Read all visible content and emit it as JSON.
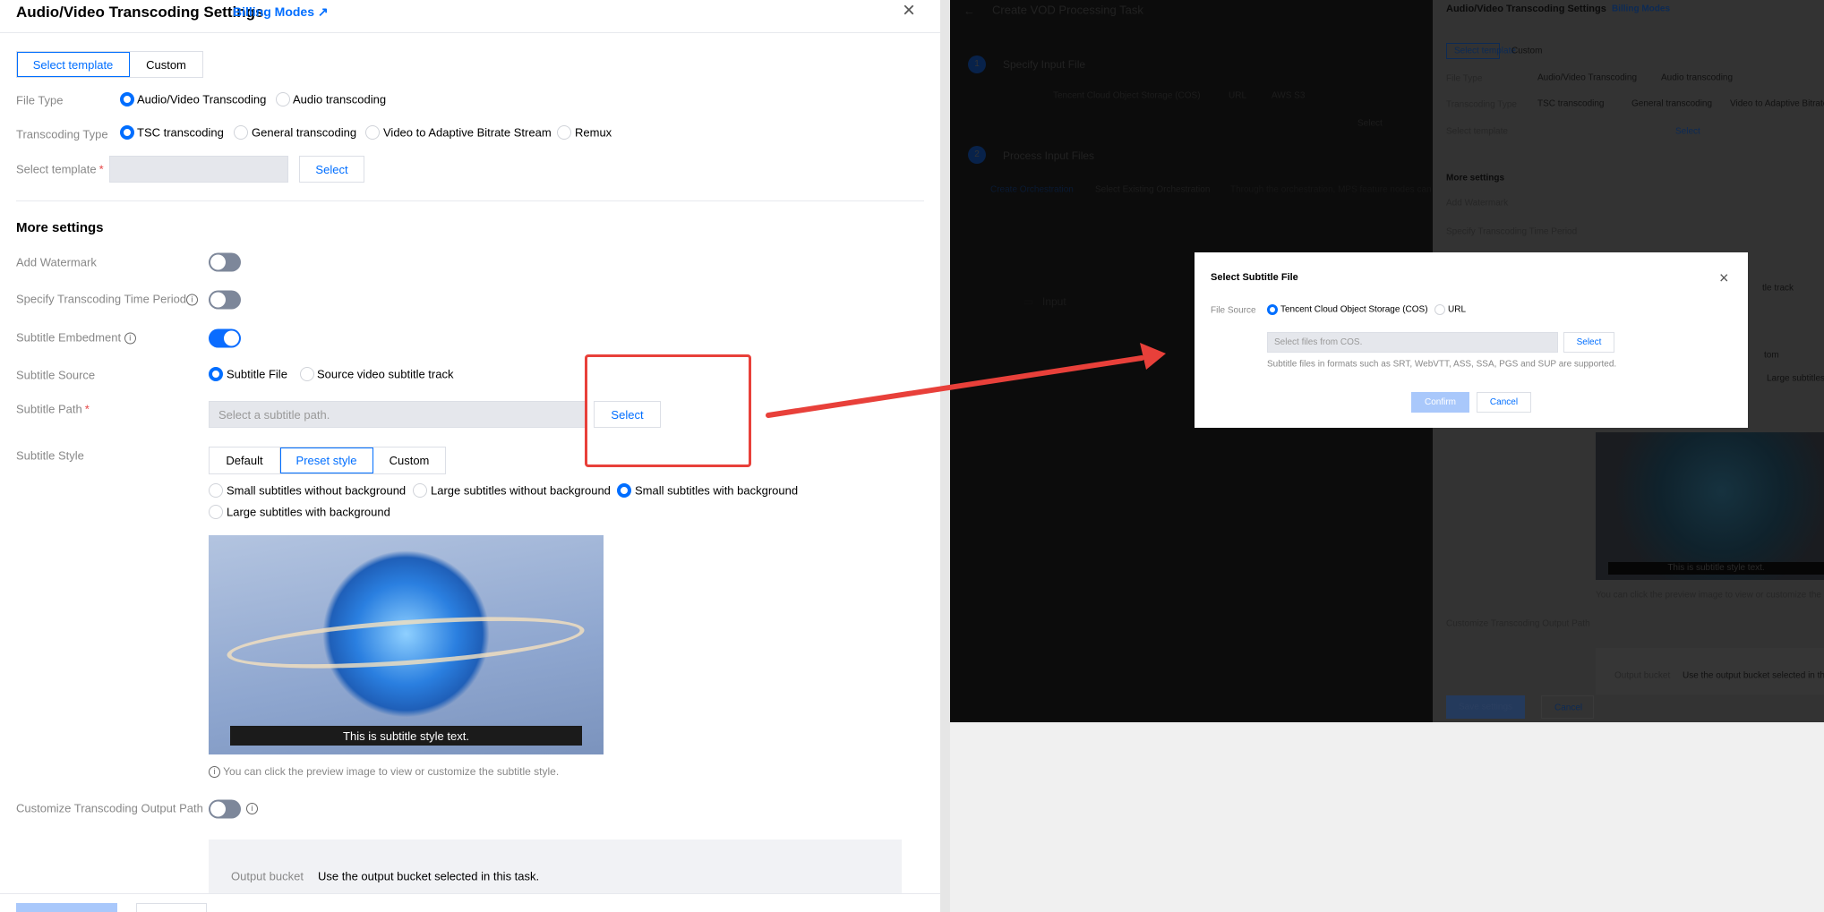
{
  "panel": {
    "title": "Audio/Video Transcoding Settings",
    "billing_link": "Billing Modes",
    "close_icon": "close-icon",
    "tabs": [
      "Select template",
      "Custom"
    ],
    "active_tab": "Select template",
    "file_type": {
      "label": "File Type",
      "options": [
        "Audio/Video Transcoding",
        "Audio transcoding"
      ],
      "selected": "Audio/Video Transcoding"
    },
    "transcoding_type": {
      "label": "Transcoding Type",
      "options": [
        "TSC transcoding",
        "General transcoding",
        "Video to Adaptive Bitrate Stream",
        "Remux"
      ],
      "selected": "TSC transcoding"
    },
    "select_template": {
      "label": "Select template",
      "value": "",
      "button": "Select"
    },
    "more_settings": "More settings",
    "add_watermark": {
      "label": "Add Watermark",
      "on": false
    },
    "time_period": {
      "label": "Specify Transcoding Time Period",
      "on": false
    },
    "subtitle_embedment": {
      "label": "Subtitle Embedment",
      "on": true
    },
    "subtitle_source": {
      "label": "Subtitle Source",
      "options": [
        "Subtitle File",
        "Source video subtitle track"
      ],
      "selected": "Subtitle File"
    },
    "subtitle_path": {
      "label": "Subtitle Path",
      "placeholder": "Select a subtitle path.",
      "button": "Select"
    },
    "subtitle_style": {
      "label": "Subtitle Style",
      "tabs": [
        "Default",
        "Preset style",
        "Custom"
      ],
      "active_tab": "Preset style",
      "options": [
        "Small subtitles without background",
        "Large subtitles without background",
        "Small subtitles with background",
        "Large subtitles with background"
      ],
      "selected": "Small subtitles with background"
    },
    "preview_subtitle": "This is subtitle style text.",
    "preview_hint": "You can click the preview image to view or customize the subtitle style.",
    "output_path": {
      "label": "Customize Transcoding Output Path",
      "on": false
    },
    "output_bucket": {
      "label": "Output bucket",
      "value": "Use the output bucket selected in this task."
    }
  },
  "background_page": {
    "title": "Create VOD Processing Task",
    "step1": {
      "number": "1",
      "title": "Specify Input File",
      "source_options": [
        "Tencent Cloud Object Storage (COS)",
        "URL",
        "AWS S3"
      ],
      "select_button": "Select"
    },
    "step2": {
      "number": "2",
      "title": "Process Input Files",
      "tabs": [
        "Create Orchestration",
        "Select Existing Orchestration"
      ],
      "description": "Through the orchestration, MPS feature nodes can be"
    },
    "input_node": "Input",
    "panel": {
      "title": "Audio/Video Transcoding Settings",
      "billing_link": "Billing Modes",
      "tabs": [
        "Select template",
        "Custom"
      ],
      "file_type_label": "File Type",
      "file_type_options": [
        "Audio/Video Transcoding",
        "Audio transcoding"
      ],
      "transcoding_type_label": "Transcoding Type",
      "transcoding_type_options": [
        "TSC transcoding",
        "General transcoding",
        "Video to Adaptive Bitrate"
      ],
      "select_template_label": "Select template",
      "select_button": "Select",
      "more_settings": "More settings",
      "add_watermark": "Add Watermark",
      "time_period": "Specify Transcoding Time Period",
      "subtitle_track_fragment": "tle track",
      "custom_fragment": "tom",
      "large_subtitles_fragment": "Large subtitles",
      "preview_subtitle": "This is subtitle style text.",
      "preview_hint": "You can click the preview image to view or customize the",
      "output_path": "Customize Transcoding Output Path",
      "output_bucket_label": "Output bucket",
      "output_bucket_value": "Use the output bucket selected in this",
      "save_button": "Save settings",
      "cancel_button": "Cancel"
    }
  },
  "modal": {
    "title": "Select Subtitle File",
    "file_source_label": "File Source",
    "options": [
      "Tencent Cloud Object Storage (COS)",
      "URL"
    ],
    "selected": "Tencent Cloud Object Storage (COS)",
    "placeholder": "Select files from COS.",
    "select_button": "Select",
    "hint": "Subtitle files in formats such as SRT, WebVTT, ASS, SSA, PGS and SUP are supported.",
    "confirm_button": "Confirm",
    "cancel_button": "Cancel"
  },
  "annotation": {
    "highlight_color": "#e8403a",
    "arrow_color": "#e8403a"
  },
  "colors": {
    "primary": "#006eff",
    "toggle_off": "#7d879a",
    "disabled_primary": "#a9c8fb"
  }
}
